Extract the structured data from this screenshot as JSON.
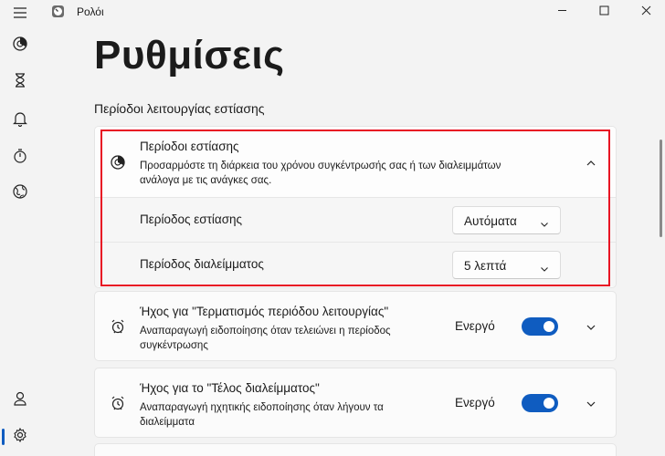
{
  "window": {
    "app_title": "Ρολόι",
    "buttons": [
      "minimize",
      "maximize",
      "close"
    ]
  },
  "nav": {
    "items": [
      {
        "icon": "menu-icon"
      },
      {
        "icon": "focus-sessions-icon"
      },
      {
        "icon": "timer-icon"
      },
      {
        "icon": "alarm-icon"
      },
      {
        "icon": "stopwatch-icon"
      },
      {
        "icon": "world-clock-icon"
      }
    ],
    "bottom_items": [
      {
        "icon": "account-icon"
      },
      {
        "icon": "settings-icon",
        "selected": true
      }
    ],
    "accent": "#0f5cc0"
  },
  "page": {
    "title": "Ρυθμίσεις",
    "section_title": "Περίοδοι λειτουργίας εστίασης"
  },
  "focus_card": {
    "title": "Περίοδοι εστίασης",
    "description_line1": "Προσαρμόστε τη διάρκεια του χρόνου συγκέντρωσής σας ή των διαλειμμάτων",
    "description_line2": "ανάλογα με τις ανάγκες σας.",
    "expanded": true,
    "rows": [
      {
        "label": "Περίοδος εστίασης",
        "value": "Αυτόματα"
      },
      {
        "label": "Περίοδος διαλείμματος",
        "value": "5 λεπτά"
      }
    ],
    "highlight_color": "#e81123"
  },
  "sound_cards": [
    {
      "title": "Ήχος για \"Τερματισμός περιόδου λειτουργίας\"",
      "description_line1": "Αναπαραγωγή ειδοποίησης όταν τελειώνει η περίοδος",
      "description_line2": "συγκέντρωσης",
      "state": "Ενεργό",
      "on": true
    },
    {
      "title": "Ήχος για το \"Τέλος διαλείμματος\"",
      "description_line1": "Αναπαραγωγή ηχητικής ειδοποίησης όταν λήγουν τα",
      "description_line2": "διαλείμματα",
      "state": "Ενεργό",
      "on": true
    }
  ]
}
